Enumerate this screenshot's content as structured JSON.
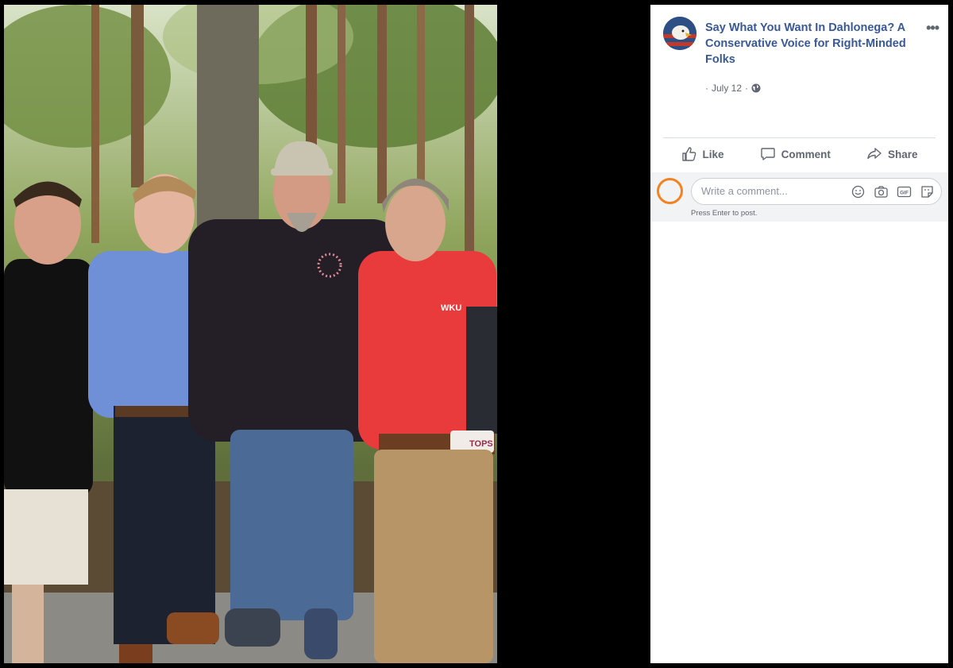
{
  "post": {
    "page_name": "Say What You Want In Dahlonega? A Conservative Voice for Right-Minded Folks",
    "date": "July 12",
    "separator": "·",
    "audience_icon": "globe-icon",
    "more_icon": "more-options-icon"
  },
  "actions": {
    "like": "Like",
    "comment": "Comment",
    "share": "Share"
  },
  "comment": {
    "placeholder": "Write a comment...",
    "hint": "Press Enter to post.",
    "icons": [
      "emoji-icon",
      "camera-icon",
      "gif-icon",
      "sticker-icon"
    ]
  },
  "photo": {
    "shirt_text_1": "WKU",
    "belt_text": "TOPS"
  },
  "colors": {
    "link": "#385898",
    "muted": "#606770",
    "highlight_ring": "#f58220",
    "comment_bg": "#f2f3f5"
  }
}
